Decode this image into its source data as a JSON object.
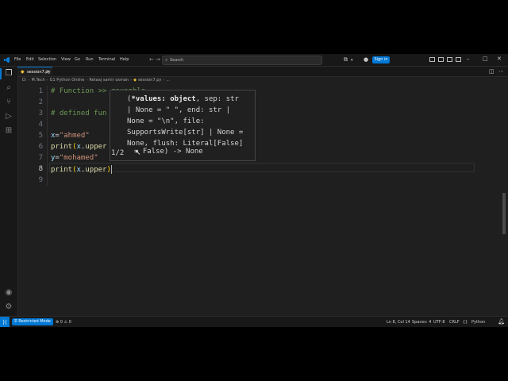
{
  "menu": [
    "File",
    "Edit",
    "Selection",
    "View",
    "Go",
    "Run",
    "Terminal",
    "Help"
  ],
  "search": {
    "placeholder": "Search"
  },
  "account": {
    "signin_label": "Sign in"
  },
  "tab": {
    "filename": "session7.py"
  },
  "breadcrumb": [
    "D:",
    "M.Tech",
    "G1 Python Online",
    "Retaaj samir osman",
    "session7.py",
    "..."
  ],
  "editor": {
    "line_numbers": [
      "1",
      "2",
      "3",
      "4",
      "5",
      "6",
      "7",
      "8",
      "9"
    ],
    "current_line": "8",
    "lines": [
      "# Function >> reusable",
      "",
      "# defined fun",
      "",
      "x=\"ahmed\"",
      "print(x.upper",
      "y=\"mohamed\"",
      "print(x.upper)",
      ""
    ]
  },
  "signature_help": {
    "lines": [
      "(*values: object, sep: str",
      "| None = \" \", end: str |",
      "None = \"\\n\", file:",
      "SupportsWrite[str] | None =",
      "None, flush: Literal[False]"
    ],
    "count": "1/2",
    "tail": "= False) -> None"
  },
  "status": {
    "restricted_mode": "Restricted Mode",
    "problems": "⊗ 0 ⚠ 0",
    "position": "Ln 8, Col 14",
    "spaces": "Spaces: 4",
    "encoding": "UTF-8",
    "eol": "CRLF",
    "language": "Python"
  },
  "colors": {
    "accent": "#0078d4",
    "editor_bg": "#1f1f1f",
    "string": "#ce9178",
    "comment": "#6a9955"
  }
}
